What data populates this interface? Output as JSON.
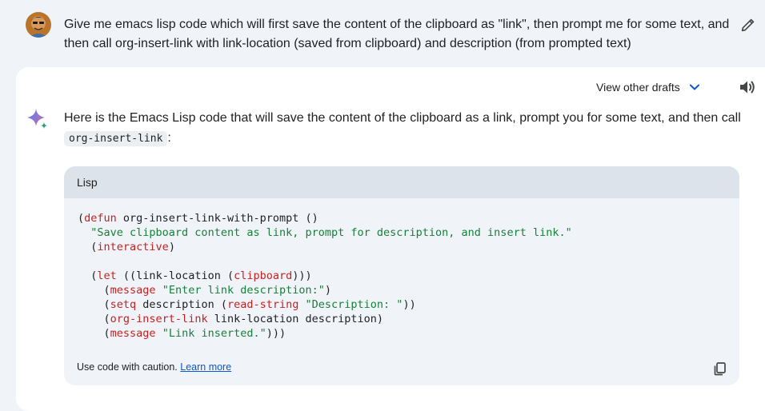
{
  "user": {
    "avatar_icon": "user-avatar-photo",
    "prompt": "Give me emacs lisp code which will first save the content of the clipboard as \"link\", then prompt me for some text, and then call org-insert-link with link-location (saved from clipboard) and description (from prompted text)",
    "edit_icon": "pencil-icon"
  },
  "response": {
    "view_drafts_label": "View other drafts",
    "drafts_icon": "chevron-down-icon",
    "speaker_icon": "speaker-icon",
    "assistant_icon": "sparkle-icon",
    "intro_text": "Here is the Emacs Lisp code that will save the content of the clipboard as a link, prompt you for some text, and then call",
    "inline_code": "org-insert-link",
    "intro_suffix": ":",
    "code_block": {
      "language": "Lisp",
      "tokens": {
        "l1_p": "(",
        "l1_kw": "defun",
        "l1_rest": " org-insert-link-with-prompt ()",
        "l2_str": "\"Save clipboard content as link, prompt for description, and insert link.\"",
        "l3_p": "(",
        "l3_kw": "interactive",
        "l3_c": ")",
        "l5_p": "(",
        "l5_kw": "let",
        "l5_m": " ((link-location (",
        "l5_fn": "clipboard",
        "l5_c": ")))",
        "l6_p": "(",
        "l6_fn": "message",
        "l6_str": "\"Enter link description:\"",
        "l6_c": ")",
        "l7_p": "(",
        "l7_kw": "setq",
        "l7_m": " description (",
        "l7_fn": "read-string",
        "l7_str": "\"Description: \"",
        "l7_c": "))",
        "l8_p": "(",
        "l8_fn": "org-insert-link",
        "l8_rest": " link-location description)",
        "l9_p": "(",
        "l9_fn": "message",
        "l9_str": "\"Link inserted.\"",
        "l9_c": ")))"
      },
      "footer_text": "Use code with caution.",
      "footer_link": "Learn more",
      "copy_icon": "copy-icon"
    }
  },
  "colors": {
    "page_background": "#f0f4f9",
    "card_background": "#ffffff",
    "keyword": "#c5221f",
    "string": "#188038",
    "link": "#0b57d0"
  }
}
